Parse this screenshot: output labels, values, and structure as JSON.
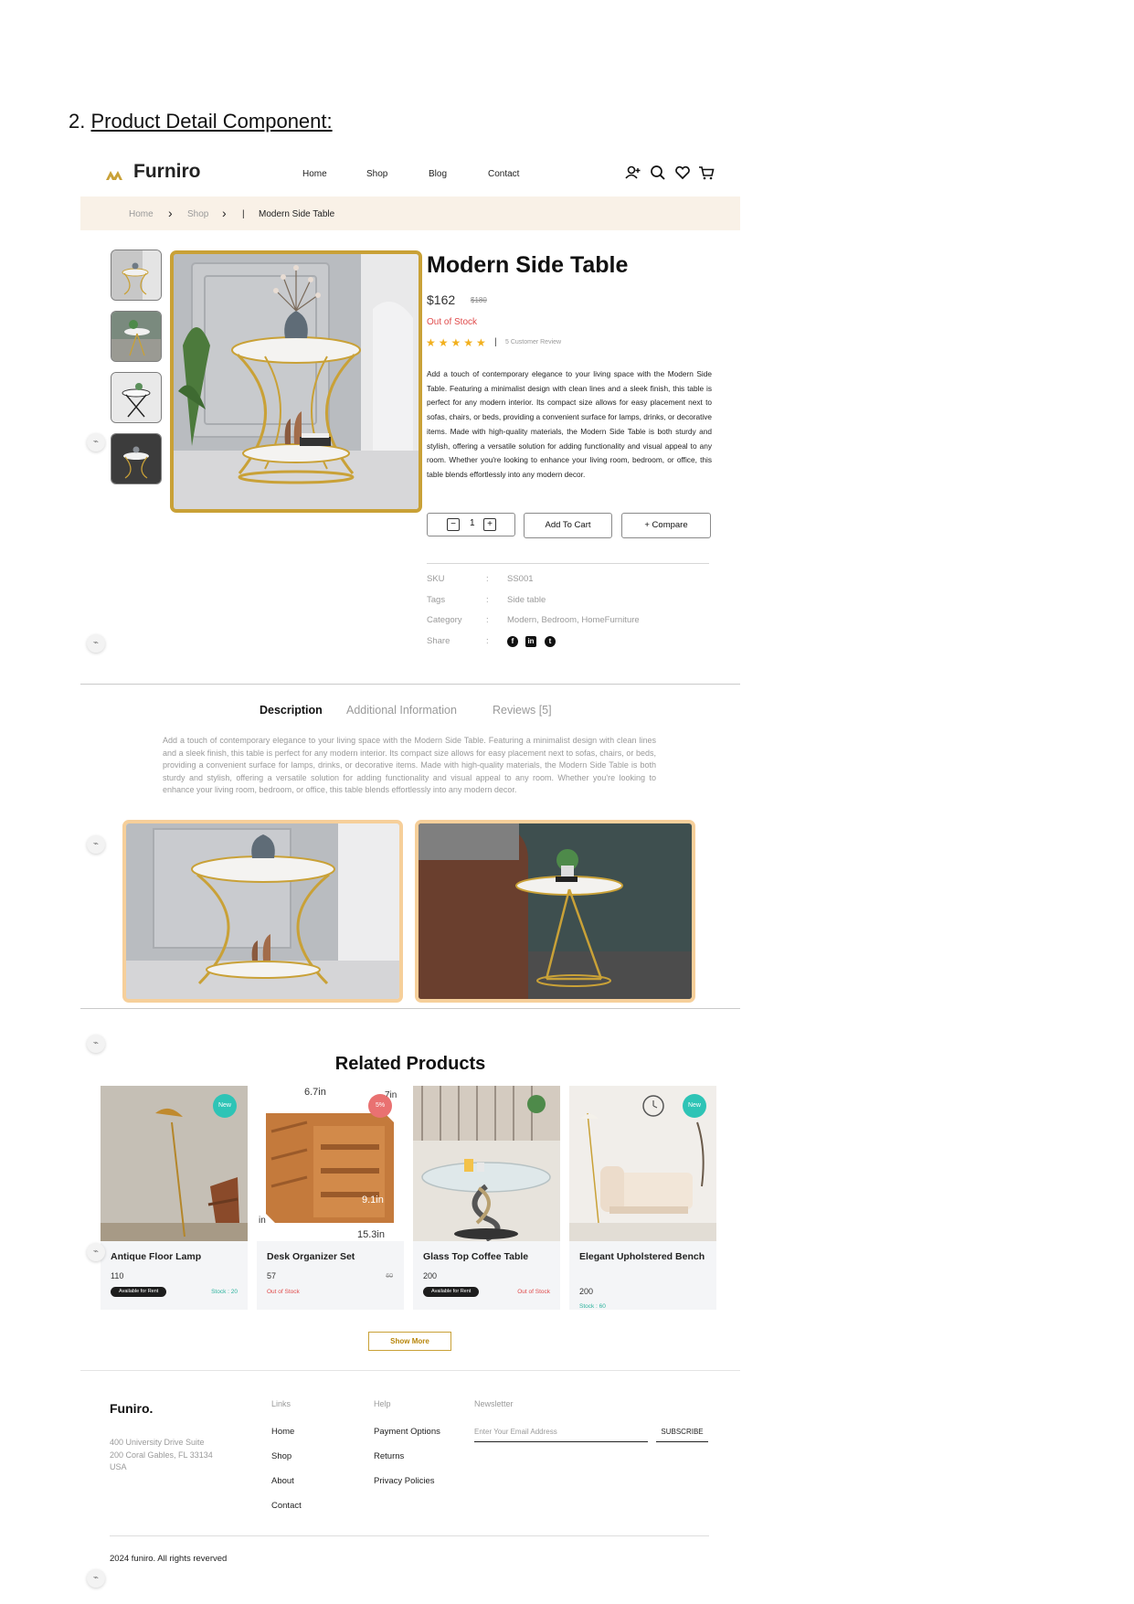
{
  "document": {
    "heading_number": "2.",
    "heading_text": "Product Detail Component:"
  },
  "header": {
    "brand": "Furniro",
    "nav": [
      "Home",
      "Shop",
      "Blog",
      "Contact"
    ],
    "icons": [
      "account-icon",
      "search-icon",
      "heart-icon",
      "cart-icon"
    ]
  },
  "breadcrumb": {
    "home": "Home",
    "shop": "Shop",
    "divider": "|",
    "current": "Modern Side Table"
  },
  "product": {
    "title": "Modern Side Table",
    "price": "$162",
    "old_price": "$180",
    "stock_status": "Out of Stock",
    "rating": 4.5,
    "stars": "★★★★★",
    "review_separator": "|",
    "review_text": "5 Customer Review",
    "description": "Add a touch of contemporary elegance to your living space with the Modern Side Table. Featuring a minimalist design with clean lines and a sleek finish, this table is perfect for any modern interior. Its compact size allows for easy placement next to sofas, chairs, or beds, providing a convenient surface for lamps, drinks, or decorative items. Made with high-quality materials, the Modern Side Table is both sturdy and stylish, offering a versatile solution for adding functionality and visual appeal to any room. Whether you're looking to enhance your living room, bedroom, or office, this table blends effortlessly into any modern decor.",
    "quantity": "1",
    "qty_minus": "−",
    "qty_plus": "+",
    "add_to_cart": "Add To Cart",
    "compare": "+ Compare",
    "meta": {
      "sku_label": "SKU",
      "sku_value": "SS001",
      "tags_label": "Tags",
      "tags_value": "Side table",
      "category_label": "Category",
      "category_value": "Modern, Bedroom, HomeFurniture",
      "share_label": "Share",
      "colon": ":"
    },
    "share_icons": [
      "facebook-icon",
      "linkedin-icon",
      "twitter-icon"
    ]
  },
  "tabs": {
    "items": [
      "Description",
      "Additional Information",
      "Reviews [5]"
    ],
    "active": "Description",
    "description": "Add a touch of contemporary elegance to your living space with the Modern Side Table. Featuring a minimalist design with clean lines and a sleek finish, this table is perfect for any modern interior. Its compact size allows for easy placement next to sofas, chairs, or beds, providing a convenient surface for lamps, drinks, or decorative items. Made with high-quality materials, the Modern Side Table is both sturdy and stylish, offering a versatile solution for adding functionality and visual appeal to any room. Whether you're looking to enhance your living room, bedroom, or office, this table blends effortlessly into any modern decor."
  },
  "related": {
    "title": "Related Products",
    "products": [
      {
        "name": "Antique Floor Lamp",
        "price": "110",
        "pill": "Available for Rent",
        "stock": "Stock : 20",
        "badge": "New"
      },
      {
        "name": "Desk Organizer Set",
        "price": "57",
        "old_price": "60",
        "stock": "Out of Stock",
        "badge": "5%",
        "dim_top": "6.7in",
        "dim_right": "9.1in",
        "dim_bottom": "15.3in",
        "dim_left": "in",
        "dim_corner": "7in"
      },
      {
        "name": "Glass Top Coffee Table",
        "price": "200",
        "pill": "Available for Rent",
        "stock": "Out of Stock"
      },
      {
        "name": "Elegant Upholstered Bench",
        "price": "200",
        "stock": "Stock : 60",
        "badge": "New"
      }
    ],
    "show_more": "Show More"
  },
  "footer": {
    "brand": "Funiro.",
    "address": [
      "400 University Drive Suite",
      "200 Coral Gables, FL 33134",
      "USA"
    ],
    "links_head": "Links",
    "links": [
      "Home",
      "Shop",
      "About",
      "Contact"
    ],
    "help_head": "Help",
    "help": [
      "Payment Options",
      "Returns",
      "Privacy Policies"
    ],
    "newsletter_head": "Newsletter",
    "email_placeholder": "Enter Your Email Address",
    "subscribe": "SUBSCRIBE",
    "copyright": "2024 funiro. All rights reverved"
  },
  "colors": {
    "accent": "#c9a137",
    "breadcrumb_bg": "#f9f1e7",
    "badge_new": "#2ec4b6",
    "badge_sale": "#e97171",
    "out_of_stock": "#e04b4b"
  }
}
